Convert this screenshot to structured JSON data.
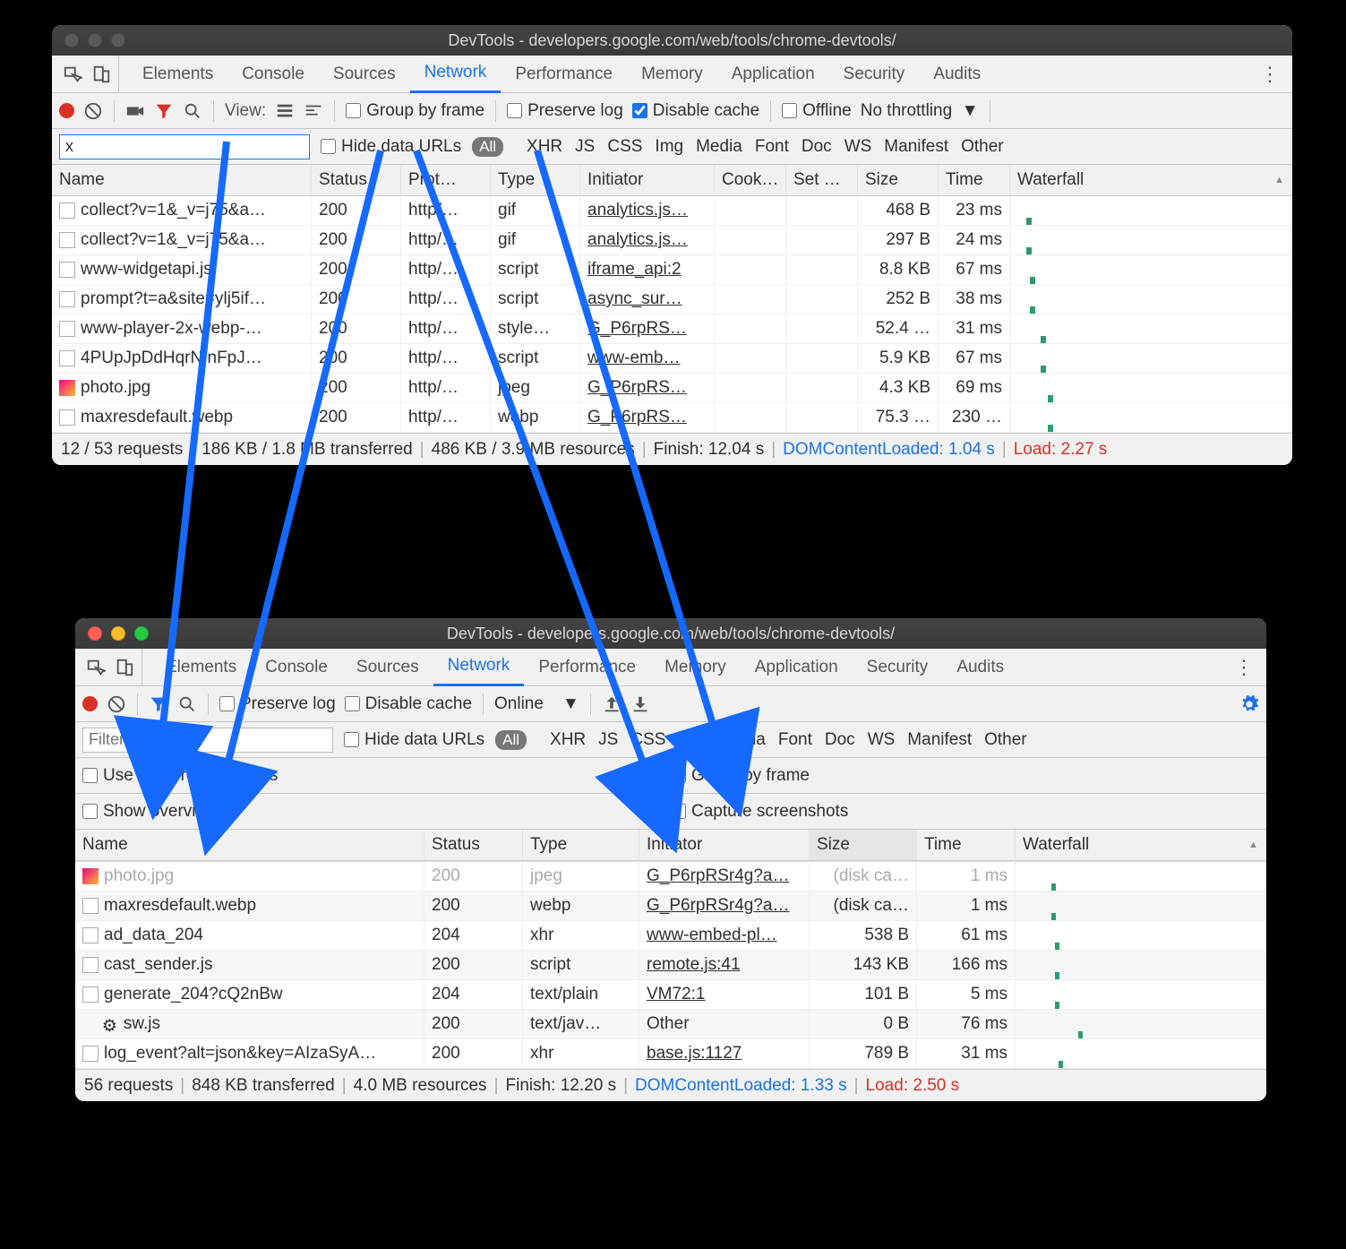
{
  "windowA": {
    "title": "DevTools - developers.google.com/web/tools/chrome-devtools/",
    "tabs": [
      "Elements",
      "Console",
      "Sources",
      "Network",
      "Performance",
      "Memory",
      "Application",
      "Security",
      "Audits"
    ],
    "active_tab": "Network",
    "toolbar": {
      "view_label": "View:",
      "group_label": "Group by frame",
      "preserve_label": "Preserve log",
      "disable_label": "Disable cache",
      "disable_checked": true,
      "offline_label": "Offline",
      "throttling": "No throttling"
    },
    "filter": {
      "value": "x",
      "hide_urls": "Hide data URLs",
      "types": [
        "XHR",
        "JS",
        "CSS",
        "Img",
        "Media",
        "Font",
        "Doc",
        "WS",
        "Manifest",
        "Other"
      ],
      "all_label": "All"
    },
    "headers": [
      "Name",
      "Status",
      "Prot…",
      "Type",
      "Initiator",
      "Cook…",
      "Set …",
      "Size",
      "Time",
      "Waterfall"
    ],
    "rows": [
      {
        "name": "collect?v=1&_v=j75&a…",
        "status": "200",
        "proto": "http/…",
        "type": "gif",
        "initiator": "analytics.js…",
        "cook": "",
        "set": "",
        "size": "468 B",
        "time": "23 ms",
        "wf": 8
      },
      {
        "name": "collect?v=1&_v=j75&a…",
        "status": "200",
        "proto": "http/…",
        "type": "gif",
        "initiator": "analytics.js…",
        "cook": "",
        "set": "",
        "size": "297 B",
        "time": "24 ms",
        "wf": 8
      },
      {
        "name": "www-widgetapi.js",
        "status": "200",
        "proto": "http/…",
        "type": "script",
        "initiator": "iframe_api:2",
        "cook": "",
        "set": "",
        "size": "8.8 KB",
        "time": "67 ms",
        "wf": 12
      },
      {
        "name": "prompt?t=a&site=ylj5if…",
        "status": "200",
        "proto": "http/…",
        "type": "script",
        "initiator": "async_sur…",
        "cook": "",
        "set": "",
        "size": "252 B",
        "time": "38 ms",
        "wf": 12
      },
      {
        "name": "www-player-2x-webp-…",
        "status": "200",
        "proto": "http/…",
        "type": "style…",
        "initiator": "G_P6rpRS…",
        "cook": "",
        "set": "",
        "size": "52.4 …",
        "time": "31 ms",
        "wf": 24
      },
      {
        "name": "4PUpJpDdHqrNInFpJ…",
        "status": "200",
        "proto": "http/…",
        "type": "script",
        "initiator": "www-emb…",
        "cook": "",
        "set": "",
        "size": "5.9 KB",
        "time": "67 ms",
        "wf": 24
      },
      {
        "name": "photo.jpg",
        "status": "200",
        "proto": "http/…",
        "type": "jpeg",
        "initiator": "G_P6rpRS…",
        "cook": "",
        "set": "",
        "size": "4.3 KB",
        "time": "69 ms",
        "wf": 32,
        "img": true
      },
      {
        "name": "maxresdefault.webp",
        "status": "200",
        "proto": "http/…",
        "type": "webp",
        "initiator": "G_P6rpRS…",
        "cook": "",
        "set": "",
        "size": "75.3 …",
        "time": "230 …",
        "wf": 32
      }
    ],
    "status": {
      "text1": "12 / 53 requests",
      "text2": "186 KB / 1.8 MB transferred",
      "text3": "486 KB / 3.9 MB resources",
      "finish": "Finish: 12.04 s",
      "dcl": "DOMContentLoaded: 1.04 s",
      "load": "Load: 2.27 s"
    }
  },
  "windowB": {
    "title": "DevTools - developers.google.com/web/tools/chrome-devtools/",
    "tabs": [
      "Elements",
      "Console",
      "Sources",
      "Network",
      "Performance",
      "Memory",
      "Application",
      "Security",
      "Audits"
    ],
    "active_tab": "Network",
    "toolbar": {
      "preserve_label": "Preserve log",
      "disable_label": "Disable cache",
      "online": "Online"
    },
    "filter": {
      "placeholder": "Filter",
      "hide_urls": "Hide data URLs",
      "types": [
        "XHR",
        "JS",
        "CSS",
        "Img",
        "Media",
        "Font",
        "Doc",
        "WS",
        "Manifest",
        "Other"
      ],
      "all_label": "All"
    },
    "settings": {
      "large_rows": "Use large request rows",
      "group_frame": "Group by frame",
      "overview": "Show overview",
      "screenshots": "Capture screenshots"
    },
    "headers": [
      "Name",
      "Status",
      "Type",
      "Initiator",
      "Size",
      "Time",
      "Waterfall"
    ],
    "rows": [
      {
        "name": "photo.jpg",
        "status": "200",
        "type": "jpeg",
        "initiator": "G_P6rpRSr4g?a…",
        "size": "(disk ca…",
        "time": "1 ms",
        "wf": 32,
        "img": true,
        "faded": true
      },
      {
        "name": "maxresdefault.webp",
        "status": "200",
        "type": "webp",
        "initiator": "G_P6rpRSr4g?a…",
        "size": "(disk ca…",
        "time": "1 ms",
        "wf": 32
      },
      {
        "name": "ad_data_204",
        "status": "204",
        "type": "xhr",
        "initiator": "www-embed-pl…",
        "size": "538 B",
        "time": "61 ms",
        "wf": 36
      },
      {
        "name": "cast_sender.js",
        "status": "200",
        "type": "script",
        "initiator": "remote.js:41",
        "size": "143 KB",
        "time": "166 ms",
        "wf": 36
      },
      {
        "name": "generate_204?cQ2nBw",
        "status": "204",
        "type": "text/plain",
        "initiator": "VM72:1",
        "size": "101 B",
        "time": "5 ms",
        "wf": 36,
        "css": true
      },
      {
        "name": "sw.js",
        "status": "200",
        "type": "text/jav…",
        "initiator": "Other",
        "size": "0 B",
        "time": "76 ms",
        "wf": 62,
        "gear": true,
        "noline": true
      },
      {
        "name": "log_event?alt=json&key=AIzaSyA…",
        "status": "200",
        "type": "xhr",
        "initiator": "base.js:1127",
        "size": "789 B",
        "time": "31 ms",
        "wf": 40
      }
    ],
    "status": {
      "text1": "56 requests",
      "text2": "848 KB transferred",
      "text3": "4.0 MB resources",
      "finish": "Finish: 12.20 s",
      "dcl": "DOMContentLoaded: 1.33 s",
      "load": "Load: 2.50 s"
    }
  }
}
